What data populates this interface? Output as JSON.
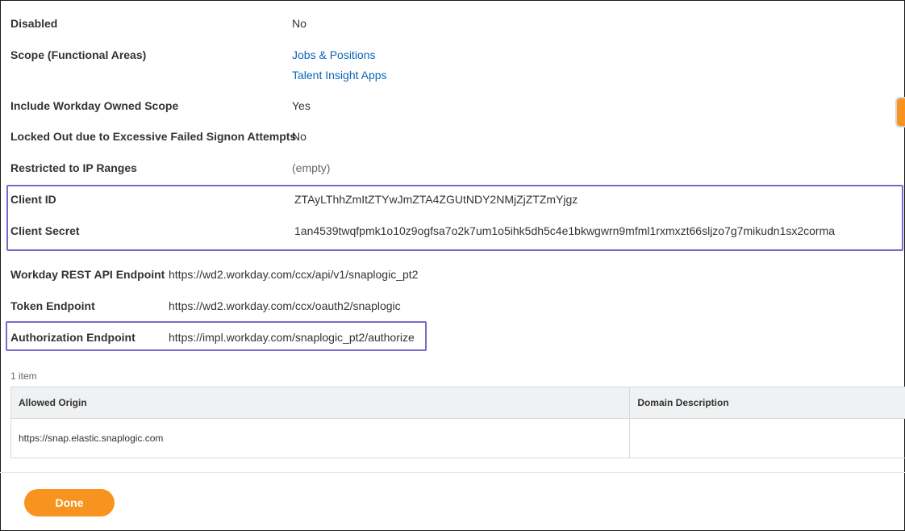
{
  "fields": {
    "disabled": {
      "label": "Disabled",
      "value": "No"
    },
    "scope": {
      "label": "Scope (Functional Areas)",
      "values": [
        "Jobs & Positions",
        "Talent Insight Apps"
      ]
    },
    "include_owned_scope": {
      "label": "Include Workday Owned Scope",
      "value": "Yes"
    },
    "locked_out": {
      "label": "Locked Out due to Excessive Failed Signon Attempts",
      "value": "No"
    },
    "restricted_ip": {
      "label": "Restricted to IP Ranges",
      "value": "(empty)"
    },
    "client_id": {
      "label": "Client ID",
      "value": "ZTAyLThhZmItZTYwJmZTA4ZGUtNDY2NMjZjZTZmYjgz"
    },
    "client_secret": {
      "label": "Client Secret",
      "value": "1an4539twqfpmk1o10z9ogfsa7o2k7um1o5ihk5dh5c4e1bkwgwrn9mfml1rxmxzt66sljzo7g7mikudn1sx2corma"
    },
    "rest_endpoint": {
      "label": "Workday REST API Endpoint",
      "value": "https://wd2.workday.com/ccx/api/v1/snaplogic_pt2"
    },
    "token_endpoint": {
      "label": "Token Endpoint",
      "value": "https://wd2.workday.com/ccx/oauth2/snaplogic"
    },
    "auth_endpoint": {
      "label": "Authorization Endpoint",
      "value": "https://impl.workday.com/snaplogic_pt2/authorize"
    }
  },
  "table": {
    "count": "1 item",
    "columns": [
      "Allowed Origin",
      "Domain Description"
    ],
    "rows": [
      [
        "https://snap.elastic.snaplogic.com",
        ""
      ]
    ]
  },
  "actions": {
    "done_label": "Done"
  },
  "colors": {
    "accent": "#f7931e",
    "link": "#0b65b8",
    "highlight": "#7b68c9"
  }
}
